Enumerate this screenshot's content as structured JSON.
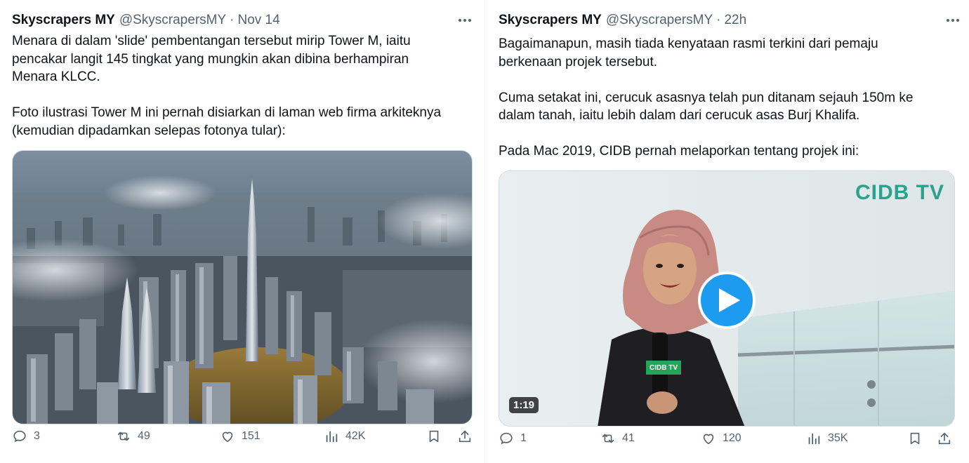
{
  "left_tweet": {
    "display_name": "Skyscrapers MY",
    "handle": "@SkyscrapersMY",
    "separator": "·",
    "time": "Nov 14",
    "text": "Menara di dalam 'slide' pembentangan tersebut mirip Tower M, iaitu\npencakar langit 145 tingkat yang mungkin akan dibina berhampiran\nMenara KLCC.\n\nFoto ilustrasi Tower M ini pernah disiarkan di laman web firma arkiteknya\n(kemudian dipadamkan selepas fotonya tular):",
    "media_icon": "city-aerial-image",
    "actions": {
      "replies": "3",
      "reposts": "49",
      "likes": "151",
      "views": "42K"
    }
  },
  "right_tweet": {
    "display_name": "Skyscrapers MY",
    "handle": "@SkyscrapersMY",
    "separator": "·",
    "time": "22h",
    "text": "Bagaimanapun, masih tiada kenyataan rasmi terkini dari pemaju\nberkenaan projek tersebut.\n\nCuma setakat ini, cerucuk asasnya telah pun ditanam sejauh 150m ke\ndalam tanah, iaitu lebih dalam dari cerucuk asas Burj Khalifa.\n\nPada Mac 2019, CIDB pernah melaporkan tentang projek ini:",
    "video": {
      "duration": "1:19",
      "brand": "CIDB TV",
      "mic_label": "CIDB TV"
    },
    "actions": {
      "replies": "1",
      "reposts": "41",
      "likes": "120",
      "views": "35K"
    }
  },
  "colors": {
    "text_primary": "#0f1419",
    "text_secondary": "#536471",
    "accent_blue": "#1d9bf0",
    "cidb_green": "#2aa28e"
  }
}
